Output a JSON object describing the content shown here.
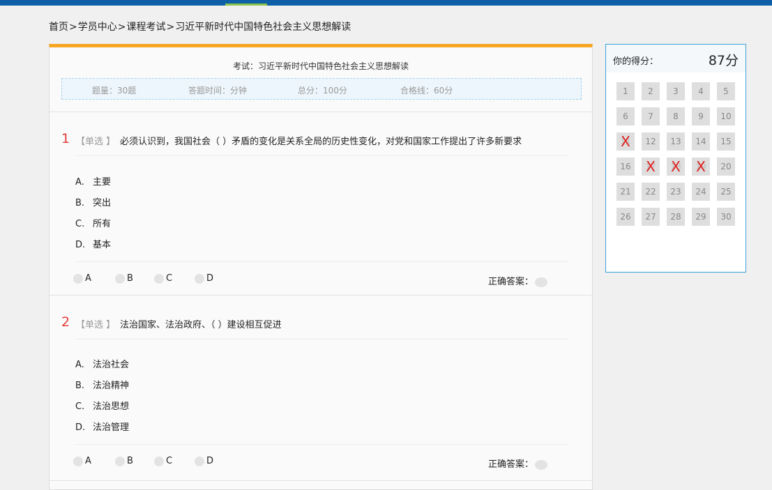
{
  "breadcrumb": [
    "首页",
    "学员中心",
    "课程考试",
    "习近平新时代中国特色社会主义思想解读"
  ],
  "breadcrumb_sep": ">",
  "exam": {
    "title": "考试：习近平新时代中国特色社会主义思想解读",
    "info": {
      "count": "题量：30题",
      "time": "答题时间：分钟",
      "total": "总分：100分",
      "pass": "合格线：60分"
    }
  },
  "questions": [
    {
      "num": "1",
      "type": "【单选 】",
      "text": "必须认识到，我国社会（   ）矛盾的变化是关系全局的历史性变化，对党和国家工作提出了许多新要求",
      "options": [
        {
          "letter": "A.",
          "text": "主要"
        },
        {
          "letter": "B.",
          "text": "突出"
        },
        {
          "letter": "C.",
          "text": "所有"
        },
        {
          "letter": "D.",
          "text": "基本"
        }
      ],
      "choices": [
        "A",
        "B",
        "C",
        "D"
      ],
      "answer_label": "正确答案："
    },
    {
      "num": "2",
      "type": "【单选 】",
      "text": "法治国家、法治政府、（   ）建设相互促进",
      "options": [
        {
          "letter": "A.",
          "text": "法治社会"
        },
        {
          "letter": "B.",
          "text": "法治精神"
        },
        {
          "letter": "C.",
          "text": "法治思想"
        },
        {
          "letter": "D.",
          "text": "法治管理"
        }
      ],
      "choices": [
        "A",
        "B",
        "C",
        "D"
      ],
      "answer_label": "正确答案："
    }
  ],
  "score_panel": {
    "label": "你的得分：",
    "score": "87分",
    "cells": [
      "1",
      "2",
      "3",
      "4",
      "5",
      "6",
      "7",
      "8",
      "9",
      "10",
      "11",
      "12",
      "13",
      "14",
      "15",
      "16",
      "17",
      "18",
      "19",
      "20",
      "21",
      "22",
      "23",
      "24",
      "25",
      "26",
      "27",
      "28",
      "29",
      "30"
    ],
    "wrong_mark": "X",
    "wrong": [
      "11",
      "17",
      "18",
      "19"
    ]
  },
  "colors": {
    "topbar": "#0d5fa8",
    "exam_accent": "#f5a623",
    "question_number": "#e23c3c",
    "wrong_mark": "#e02020",
    "panel_border": "#3ba2d8"
  }
}
